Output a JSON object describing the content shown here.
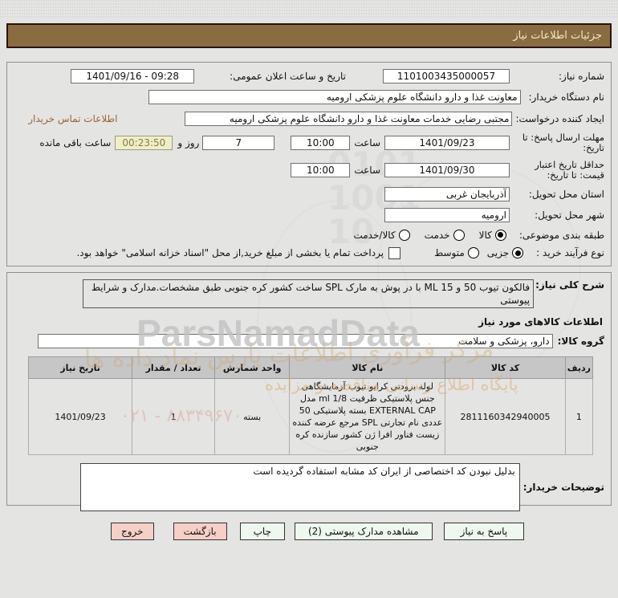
{
  "title_bar": {
    "text": "جزئیات اطلاعات نیاز"
  },
  "watermarks": {
    "brand": "ParsNamadData",
    "fa_line1": "مرکز فرآوری اطلاعات پارس نماد داده ها",
    "fa_line2": "پایگاه اطلاع رسانی مناقصه و مزایده",
    "phone": "۰۲۱ - ۸۸۳۴۹۶۷۰",
    "ghost_digits": "0101\n1001\n10"
  },
  "info": {
    "need_number": {
      "label": "شماره نیاز:",
      "value": "1101003435000057"
    },
    "announce": {
      "label": "تاریخ و ساعت اعلان عمومی:",
      "value": "1401/09/16 - 09:28"
    },
    "buyer_org": {
      "label": "نام دستگاه خریدار:",
      "value": "معاونت غذا و دارو دانشگاه علوم پزشکی ارومیه"
    },
    "requester": {
      "label": "ایجاد کننده درخواست:",
      "value": "مجتبی رضایی خدمات معاونت غذا و دارو دانشگاه علوم پزشکی ارومیه",
      "contact_link": "اطلاعات تماس خریدار"
    },
    "deadline": {
      "label": "مهلت ارسال پاسخ: تا تاریخ:",
      "date": "1401/09/23",
      "hour_label": "ساعت",
      "time": "10:00",
      "days": "7",
      "days_label": "روز و",
      "countdown": "00:23:50",
      "countdown_label": "ساعت باقی مانده"
    },
    "validity": {
      "label": "حداقل تاریخ اعتبار قیمت: تا تاریخ:",
      "date": "1401/09/30",
      "hour_label": "ساعت",
      "time": "10:00"
    },
    "province": {
      "label": "استان محل تحویل:",
      "value": "آذربایجان غربی"
    },
    "city": {
      "label": "شهر محل تحویل:",
      "value": "ارومیه"
    },
    "category": {
      "label": "طبقه بندی موضوعی:",
      "options": [
        {
          "label": "کالا",
          "selected": true
        },
        {
          "label": "خدمت",
          "selected": false
        },
        {
          "label": "کالا/خدمت",
          "selected": false
        }
      ]
    },
    "process": {
      "label": "نوع فرآیند خرید :",
      "options": [
        {
          "label": "جزیی",
          "selected": true
        },
        {
          "label": "متوسط",
          "selected": false
        }
      ],
      "treasury_note": "پرداخت تمام یا بخشی از مبلغ خرید,از محل \"اسناد خزانه اسلامی\" خواهد بود."
    }
  },
  "need_desc": {
    "label": "شرح کلی نیاز:",
    "value": "فالکون تیوب 50 و ML 15  با در پوش به مارک SPL  ساخت کشور کره جنوبی طبق مشخصات.مدارک و شرایط پیوستی"
  },
  "goods": {
    "section_title": "اطلاعات کالاهای مورد نیاز",
    "group": {
      "label": "گروه کالا:",
      "value": "دارو، پزشکی و سلامت"
    },
    "table": {
      "headers": [
        "ردیف",
        "کد کالا",
        "نام کالا",
        "واحد شمارش",
        "تعداد / مقدار",
        "تاریخ نیاز"
      ],
      "rows": [
        {
          "row_no": "1",
          "code": "2811160342940005",
          "name": "لوله برودتی کرایو تیوب آزمایشگاهی جنس پلاستیکی ظرفیت ml 1/8 مدل EXTERNAL CAP بسته پلاستیکی 50 عددی نام تجارتی SPL مرجع عرضه کننده زیست فناور افرا ژن کشور سازنده کره جنوبی",
          "unit": "بسته",
          "qty": "1",
          "date": "1401/09/23"
        }
      ]
    }
  },
  "comments": {
    "label": "توضیحات خریدار:",
    "value": "بدلیل نبودن کد اختصاصی از ایران کد مشابه استفاده گردیده است"
  },
  "buttons": {
    "exit": "خروج",
    "back": "بازگشت",
    "print": "چاپ",
    "attachments": "مشاهده مدارک پیوستی (2)",
    "respond": "پاسخ به نیاز"
  },
  "colors": {
    "header_bg": "#8a6c41",
    "countdown_bg": "#f1edc7",
    "button_pink": "#f6cfc7",
    "button_green": "#eef8ef",
    "link": "#996633"
  }
}
